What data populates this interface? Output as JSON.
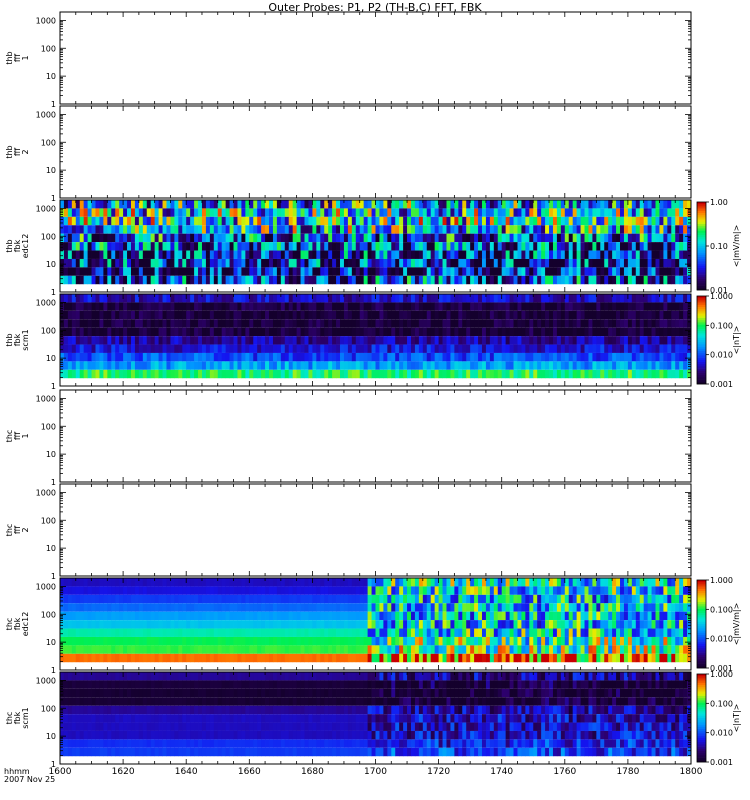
{
  "title": "Outer Probes: P1, P2 (TH-B,C) FFT, FBK",
  "chart_data": {
    "type": "heatmap",
    "title": "Outer Probes: P1, P2 (TH-B,C) FFT, FBK",
    "x_axis": {
      "range": [
        1600,
        1800
      ],
      "ticks": [
        "1600",
        "1620",
        "1640",
        "1660",
        "1680",
        "1700",
        "1720",
        "1740",
        "1760",
        "1780",
        "1800"
      ],
      "label_lines": [
        "hhmm",
        "2007 Nov 25"
      ]
    },
    "y_axis": {
      "scale": "log",
      "ticks": [
        "1",
        "10",
        "100",
        "1000"
      ]
    },
    "panels": [
      {
        "id": "thb-fff-1",
        "label_lines": [
          "thb",
          "fff",
          "1"
        ],
        "type": "empty"
      },
      {
        "id": "thb-fff-2",
        "label_lines": [
          "thb",
          "fff",
          "2"
        ],
        "type": "empty"
      },
      {
        "id": "thb-fbk-edc12",
        "label_lines": [
          "thb",
          "fbk",
          "edc12"
        ],
        "type": "spectrogram",
        "colorbar": {
          "title": "<|mV/m|>",
          "scale": "log",
          "ticks": [
            "1.00",
            "0.10",
            "0.01"
          ]
        },
        "bands": [
          {
            "f": 1300,
            "v": 0.08
          },
          {
            "f": 650,
            "v": 0.12
          },
          {
            "f": 330,
            "v": 0.13
          },
          {
            "f": 165,
            "v": 0.1
          },
          {
            "f": 83,
            "v": 0.05
          },
          {
            "f": 41,
            "v": 0.04
          },
          {
            "f": 21,
            "v": 0.03
          },
          {
            "f": 10,
            "v": 0.025
          },
          {
            "f": 5,
            "v": 0.02
          },
          {
            "f": 2.6,
            "v": 0.04
          }
        ],
        "variability": 0.85
      },
      {
        "id": "thb-fbk-scm1",
        "label_lines": [
          "thb",
          "fbk",
          "scm1"
        ],
        "type": "spectrogram",
        "colorbar": {
          "title": "<|nT|>",
          "scale": "log",
          "ticks": [
            "1.000",
            "0.100",
            "0.010",
            "0.001"
          ]
        },
        "bands": [
          {
            "f": 1500,
            "v": 0.004
          },
          {
            "f": 700,
            "v": 0.0012
          },
          {
            "f": 330,
            "v": 0.0011
          },
          {
            "f": 160,
            "v": 0.0011
          },
          {
            "f": 80,
            "v": 0.0011
          },
          {
            "f": 40,
            "v": 0.003
          },
          {
            "f": 20,
            "v": 0.005
          },
          {
            "f": 10,
            "v": 0.009
          },
          {
            "f": 5,
            "v": 0.02
          },
          {
            "f": 2.6,
            "v": 0.09
          }
        ],
        "variability": 0.2
      },
      {
        "id": "thc-fff-1",
        "label_lines": [
          "thc",
          "fff",
          "1"
        ],
        "type": "empty"
      },
      {
        "id": "thc-fff-2",
        "label_lines": [
          "thc",
          "fff",
          "2"
        ],
        "type": "empty"
      },
      {
        "id": "thc-fbk-edc12",
        "label_lines": [
          "thc",
          "fbk",
          "edc12"
        ],
        "type": "spectrogram",
        "colorbar": {
          "title": "<|mV/m|>",
          "scale": "log",
          "ticks": [
            "1.000",
            "0.100",
            "0.010",
            "0.001"
          ]
        },
        "data_start": 1698,
        "bands_before": [
          {
            "f": 1500,
            "v": 0.004
          },
          {
            "f": 700,
            "v": 0.005
          },
          {
            "f": 330,
            "v": 0.008
          },
          {
            "f": 160,
            "v": 0.012
          },
          {
            "f": 80,
            "v": 0.02
          },
          {
            "f": 40,
            "v": 0.03
          },
          {
            "f": 20,
            "v": 0.06
          },
          {
            "f": 10,
            "v": 0.1
          },
          {
            "f": 5,
            "v": 0.12
          },
          {
            "f": 2.6,
            "v": 0.5
          }
        ],
        "bands": [
          {
            "f": 1500,
            "v": 0.05
          },
          {
            "f": 700,
            "v": 0.04
          },
          {
            "f": 330,
            "v": 0.03
          },
          {
            "f": 160,
            "v": 0.03
          },
          {
            "f": 80,
            "v": 0.03
          },
          {
            "f": 40,
            "v": 0.03
          },
          {
            "f": 20,
            "v": 0.04
          },
          {
            "f": 10,
            "v": 0.07
          },
          {
            "f": 5,
            "v": 0.09
          },
          {
            "f": 2.6,
            "v": 0.5
          }
        ],
        "variability": 0.6
      },
      {
        "id": "thc-fbk-scm1",
        "label_lines": [
          "thc",
          "fbk",
          "scm1"
        ],
        "type": "spectrogram",
        "colorbar": {
          "title": "<|nT|>",
          "scale": "log",
          "ticks": [
            "1.000",
            "0.100",
            "0.010",
            "0.001"
          ]
        },
        "data_start": 1698,
        "bands_before": [
          {
            "f": 1500,
            "v": 0.003
          },
          {
            "f": 700,
            "v": 0.0012
          },
          {
            "f": 330,
            "v": 0.0011
          },
          {
            "f": 160,
            "v": 0.0011
          },
          {
            "f": 80,
            "v": 0.003
          },
          {
            "f": 40,
            "v": 0.004
          },
          {
            "f": 20,
            "v": 0.004
          },
          {
            "f": 10,
            "v": 0.004
          },
          {
            "f": 5,
            "v": 0.007
          },
          {
            "f": 2.6,
            "v": 0.008
          }
        ],
        "bands": [
          {
            "f": 1500,
            "v": 0.003
          },
          {
            "f": 700,
            "v": 0.0012
          },
          {
            "f": 330,
            "v": 0.0011
          },
          {
            "f": 160,
            "v": 0.0011
          },
          {
            "f": 80,
            "v": 0.003
          },
          {
            "f": 40,
            "v": 0.004
          },
          {
            "f": 20,
            "v": 0.004
          },
          {
            "f": 10,
            "v": 0.004
          },
          {
            "f": 5,
            "v": 0.006
          },
          {
            "f": 2.6,
            "v": 0.008
          }
        ],
        "variability": 0.3
      }
    ]
  }
}
